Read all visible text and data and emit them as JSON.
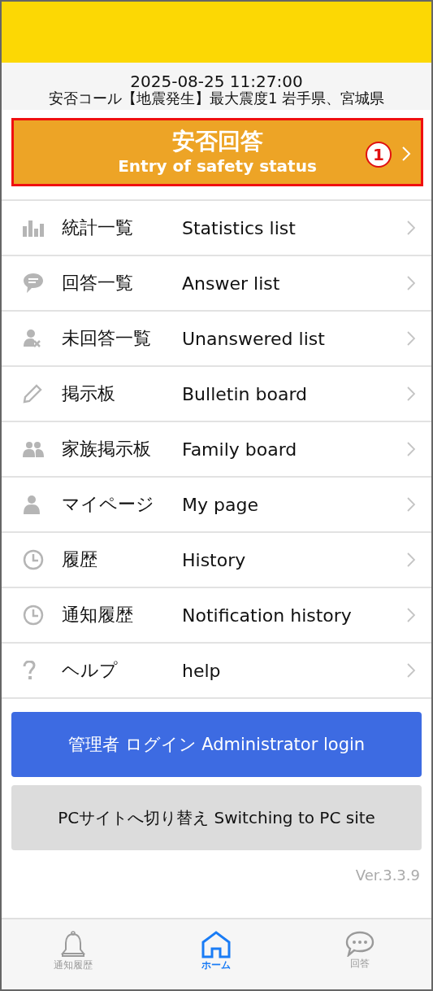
{
  "header": {
    "datetime": "2025-08-25 11:27:00",
    "message": "安否コール【地震発生】最大震度1 岩手県、宮城県"
  },
  "primary_button": {
    "title": "安否回答",
    "subtitle": "Entry of safety status",
    "badge": "1"
  },
  "menu": [
    {
      "ja": "統計一覧",
      "en": "Statistics list"
    },
    {
      "ja": "回答一覧",
      "en": "Answer list"
    },
    {
      "ja": "未回答一覧",
      "en": "Unanswered list"
    },
    {
      "ja": "掲示板",
      "en": "Bulletin board"
    },
    {
      "ja": "家族掲示板",
      "en": "Family board"
    },
    {
      "ja": "マイページ",
      "en": "My page"
    },
    {
      "ja": "履歴",
      "en": "History"
    },
    {
      "ja": "通知履歴",
      "en": "Notification history"
    },
    {
      "ja": "ヘルプ",
      "en": "help"
    }
  ],
  "admin_button": "管理者 ログイン Administrator login",
  "pc_button": "PCサイトへ切り替え Switching to PC site",
  "version": "Ver.3.3.9",
  "tabs": [
    {
      "label": "通知履歴",
      "selected": false
    },
    {
      "label": "ホーム",
      "selected": true
    },
    {
      "label": "回答",
      "selected": false
    }
  ]
}
